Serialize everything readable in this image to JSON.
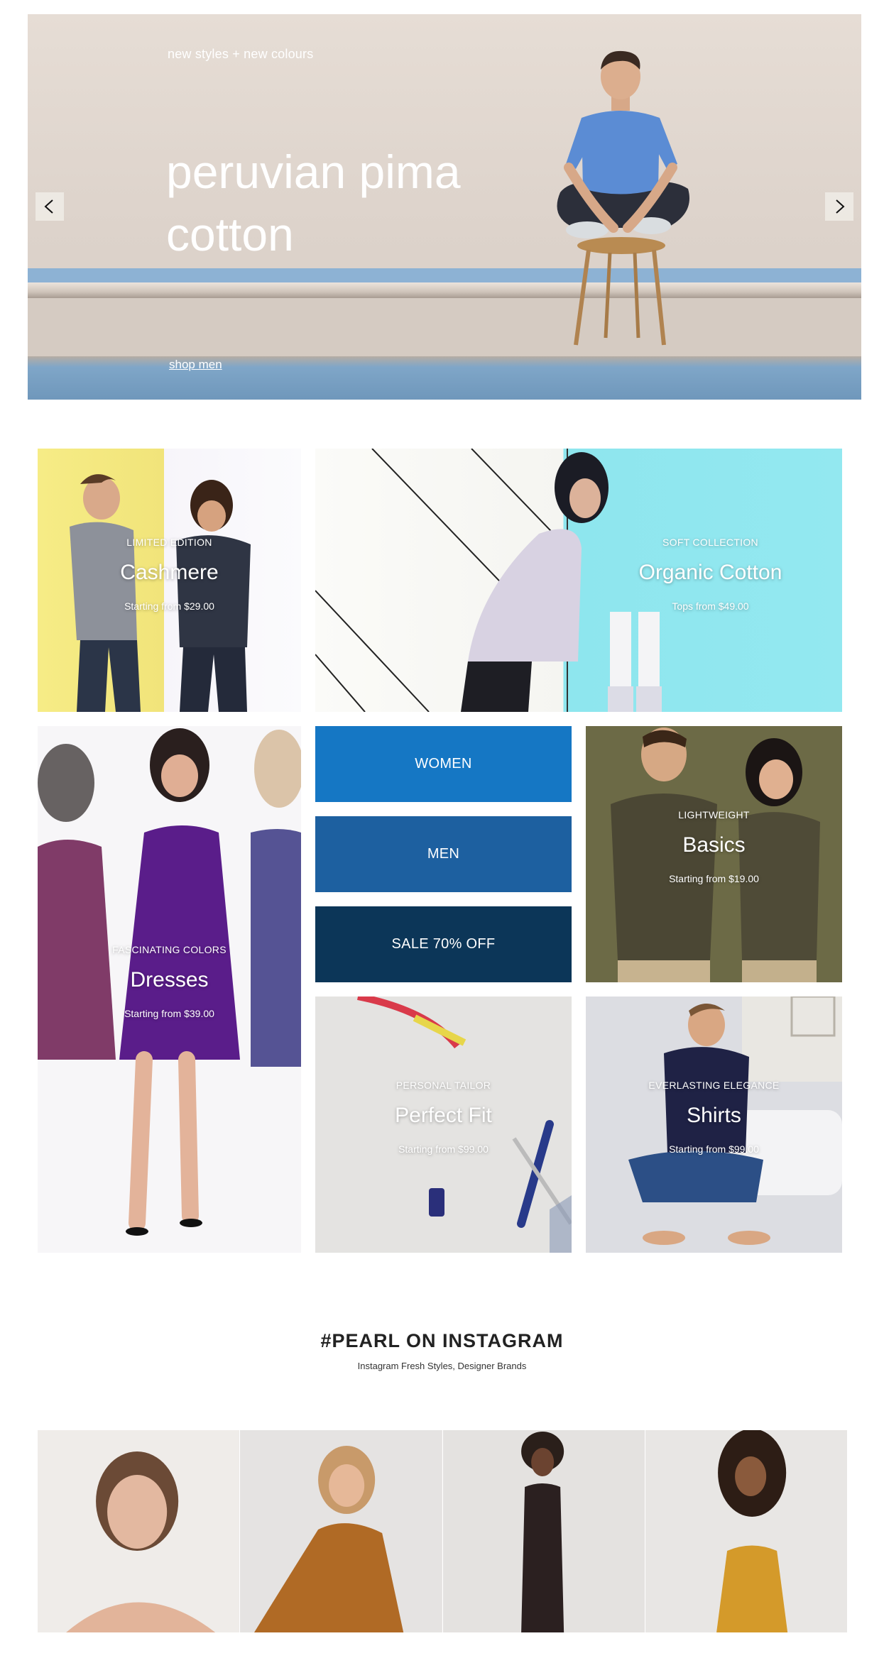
{
  "hero": {
    "kicker": "new styles + new colours",
    "headline": "peruvian pima cotton",
    "cta": "shop men"
  },
  "tiles": {
    "cashmere": {
      "eyebrow": "LIMITED EDITION",
      "title": "Cashmere",
      "sub": "Starting from $29.00"
    },
    "organic": {
      "eyebrow": "SOFT COLLECTION",
      "title": "Organic Cotton",
      "sub": "Tops from $49.00"
    },
    "dresses": {
      "eyebrow": "FASCINATING COLORS",
      "title": "Dresses",
      "sub": "Starting from $39.00"
    },
    "basics": {
      "eyebrow": "LIGHTWEIGHT",
      "title": "Basics",
      "sub": "Starting from $19.00"
    },
    "fit": {
      "eyebrow": "PERSONAL TAILOR",
      "title": "Perfect Fit",
      "sub": "Starting from $99.00"
    },
    "shirts": {
      "eyebrow": "EVERLASTING ELEGANCE",
      "title": "Shirts",
      "sub": "Starting from $99.00"
    }
  },
  "categories": {
    "women": "WOMEN",
    "men": "MEN",
    "sale": "SALE 70% OFF"
  },
  "colors": {
    "women": "#1577c4",
    "men": "#1d60a0",
    "sale": "#0c3658"
  },
  "instagram": {
    "title": "#PEARL ON INSTAGRAM",
    "subtitle": "Instagram Fresh Styles, Designer Brands"
  }
}
